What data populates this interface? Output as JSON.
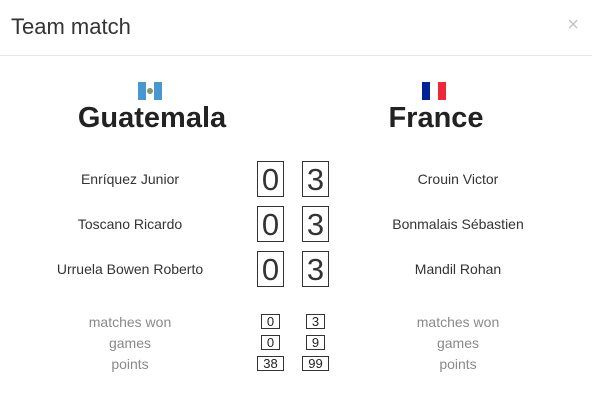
{
  "dialog": {
    "title": "Team match"
  },
  "teams": {
    "home": {
      "name": "Guatemala",
      "flag_colors": [
        "#4997d0",
        "#ffffff",
        "#4997d0"
      ]
    },
    "away": {
      "name": "France",
      "flag_colors": [
        "#002395",
        "#ffffff",
        "#ed2939"
      ]
    }
  },
  "matches": [
    {
      "home_player": "Enríquez Junior",
      "home_score": "0",
      "away_score": "3",
      "away_player": "Crouin Victor"
    },
    {
      "home_player": "Toscano Ricardo",
      "home_score": "0",
      "away_score": "3",
      "away_player": "Bonmalais Sébastien"
    },
    {
      "home_player": "Urruela Bowen Roberto",
      "home_score": "0",
      "away_score": "3",
      "away_player": "Mandil Rohan"
    }
  ],
  "stats": [
    {
      "label": "matches won",
      "home": "0",
      "away": "3"
    },
    {
      "label": "games",
      "home": "0",
      "away": "9"
    },
    {
      "label": "points",
      "home": "38",
      "away": "99"
    }
  ]
}
